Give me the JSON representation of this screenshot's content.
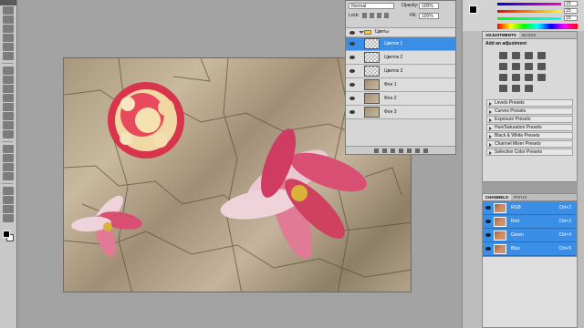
{
  "tools": {
    "icons": [
      "move-tool-icon",
      "marquee-tool-icon",
      "lasso-tool-icon",
      "quick-select-tool-icon",
      "crop-tool-icon",
      "eyedropper-tool-icon",
      "healing-brush-icon",
      "brush-tool-icon",
      "clone-stamp-icon",
      "history-brush-icon",
      "eraser-tool-icon",
      "gradient-tool-icon",
      "blur-tool-icon",
      "dodge-tool-icon",
      "pen-tool-icon",
      "type-tool-icon",
      "path-select-icon",
      "shape-tool-icon",
      "3d-rotate-icon",
      "3d-orbit-icon",
      "hand-tool-icon",
      "zoom-tool-icon"
    ]
  },
  "layers_panel": {
    "blend_mode": "Normal",
    "opacity_label": "Opacity:",
    "opacity_value": "100%",
    "lock_label": "Lock:",
    "fill_label": "Fill:",
    "fill_value": "100%",
    "group_name": "Цветы",
    "layers": [
      {
        "name": "Цветок 1",
        "selected": true
      },
      {
        "name": "Цветок 2",
        "selected": false
      },
      {
        "name": "Цветок 3",
        "selected": false
      },
      {
        "name": "Фон 1",
        "selected": false
      },
      {
        "name": "Фон 2",
        "selected": false
      },
      {
        "name": "Фон 3",
        "selected": false
      }
    ]
  },
  "color_panel": {
    "r_value": "15",
    "g_value": "15",
    "b_value": "15"
  },
  "adjustments_panel": {
    "tabs": [
      "ADJUSTMENTS",
      "MASKS"
    ],
    "title": "Add an adjustment",
    "presets": [
      "Levels Presets",
      "Curves Presets",
      "Exposure Presets",
      "Hue/Saturation Presets",
      "Black & White Presets",
      "Channel Mixer Presets",
      "Selective Color Presets"
    ]
  },
  "channels_panel": {
    "tabs": [
      "CHANNELS",
      "PATHS"
    ],
    "channels": [
      {
        "name": "RGB",
        "shortcut": "Ctrl+2"
      },
      {
        "name": "Red",
        "shortcut": "Ctrl+3"
      },
      {
        "name": "Green",
        "shortcut": "Ctrl+4"
      },
      {
        "name": "Blue",
        "shortcut": "Ctrl+5"
      }
    ]
  },
  "colors": {
    "selection": "#3a8ee6",
    "panel_bg": "#d6d6d6",
    "workspace": "#a3a3a3"
  }
}
